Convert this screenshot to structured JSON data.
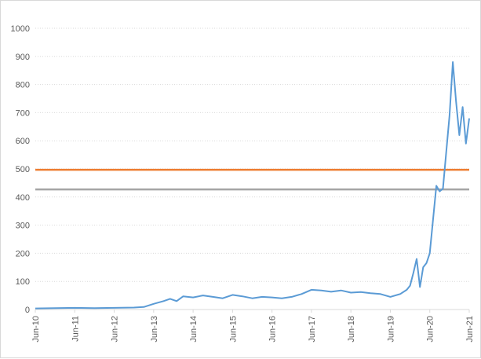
{
  "chart_data": {
    "type": "line",
    "title": "",
    "xlabel": "",
    "ylabel": "",
    "ylim": [
      0,
      1000
    ],
    "yticks": [
      0,
      100,
      200,
      300,
      400,
      500,
      600,
      700,
      800,
      900,
      1000
    ],
    "xlim": [
      "2010-06",
      "2021-06"
    ],
    "xticks": [
      "Jun-10",
      "Jun-11",
      "Jun-12",
      "Jun-13",
      "Jun-14",
      "Jun-15",
      "Jun-16",
      "Jun-17",
      "Jun-18",
      "Jun-19",
      "Jun-20",
      "Jun-21"
    ],
    "grid": true,
    "legend": "none",
    "series": [
      {
        "color": "#5b9bd5",
        "points": [
          [
            "2010-06",
            4
          ],
          [
            "2010-12",
            5
          ],
          [
            "2011-06",
            6
          ],
          [
            "2011-12",
            5
          ],
          [
            "2012-06",
            6
          ],
          [
            "2012-12",
            7
          ],
          [
            "2013-03",
            9
          ],
          [
            "2013-06",
            20
          ],
          [
            "2013-09",
            30
          ],
          [
            "2013-11",
            38
          ],
          [
            "2014-01",
            30
          ],
          [
            "2014-03",
            47
          ],
          [
            "2014-06",
            43
          ],
          [
            "2014-09",
            50
          ],
          [
            "2014-12",
            45
          ],
          [
            "2015-03",
            40
          ],
          [
            "2015-06",
            52
          ],
          [
            "2015-09",
            47
          ],
          [
            "2015-12",
            40
          ],
          [
            "2016-03",
            45
          ],
          [
            "2016-06",
            43
          ],
          [
            "2016-09",
            40
          ],
          [
            "2016-12",
            45
          ],
          [
            "2017-03",
            55
          ],
          [
            "2017-06",
            70
          ],
          [
            "2017-09",
            68
          ],
          [
            "2017-12",
            63
          ],
          [
            "2018-03",
            68
          ],
          [
            "2018-06",
            60
          ],
          [
            "2018-09",
            62
          ],
          [
            "2018-12",
            58
          ],
          [
            "2019-03",
            55
          ],
          [
            "2019-06",
            45
          ],
          [
            "2019-09",
            55
          ],
          [
            "2019-11",
            70
          ],
          [
            "2019-12",
            85
          ],
          [
            "2020-01",
            130
          ],
          [
            "2020-02",
            180
          ],
          [
            "2020-03",
            80
          ],
          [
            "2020-04",
            150
          ],
          [
            "2020-05",
            165
          ],
          [
            "2020-06",
            200
          ],
          [
            "2020-07",
            320
          ],
          [
            "2020-08",
            440
          ],
          [
            "2020-09",
            420
          ],
          [
            "2020-10",
            430
          ],
          [
            "2020-11",
            560
          ],
          [
            "2020-12",
            690
          ],
          [
            "2021-01",
            880
          ],
          [
            "2021-02",
            740
          ],
          [
            "2021-03",
            620
          ],
          [
            "2021-04",
            720
          ],
          [
            "2021-05",
            590
          ],
          [
            "2021-06",
            680
          ]
        ]
      },
      {
        "color": "#ed7d31",
        "points": [
          [
            "2010-06",
            497
          ],
          [
            "2021-06",
            497
          ]
        ]
      },
      {
        "color": "#a5a5a5",
        "points": [
          [
            "2010-06",
            427
          ],
          [
            "2021-06",
            427
          ]
        ]
      }
    ]
  }
}
